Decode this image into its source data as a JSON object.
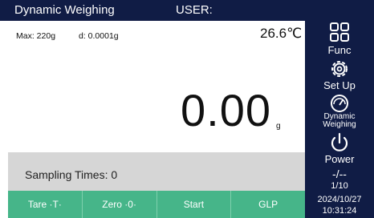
{
  "header": {
    "title": "Dynamic Weighing",
    "user_label": "USER:"
  },
  "display": {
    "max_capacity": "Max: 220g",
    "readability": "d: 0.0001g",
    "temperature": "26.6℃",
    "weight_value": "0.00",
    "weight_unit": "g"
  },
  "sampling": {
    "label": "Sampling Times: 0"
  },
  "softkeys": [
    {
      "label": "Tare ·T·"
    },
    {
      "label": "Zero ·0·"
    },
    {
      "label": "Start"
    },
    {
      "label": "GLP"
    }
  ],
  "side_menu": {
    "func_label": "Func",
    "setup_label": "Set Up",
    "dynamic_label_1": "Dynamic",
    "dynamic_label_2": "Weighing",
    "power_label": "Power",
    "level_indicator": "-/--",
    "page_indicator": "1/10",
    "date": "2024/10/27",
    "time": "10:31:24"
  },
  "icons": {
    "func": "grid-icon",
    "setup": "gear-icon",
    "dynamic": "gauge-icon",
    "power": "power-icon"
  },
  "colors": {
    "panel_dark": "#101c45",
    "softkey_green": "#46b589",
    "sampling_gray": "#d6d6d6"
  }
}
